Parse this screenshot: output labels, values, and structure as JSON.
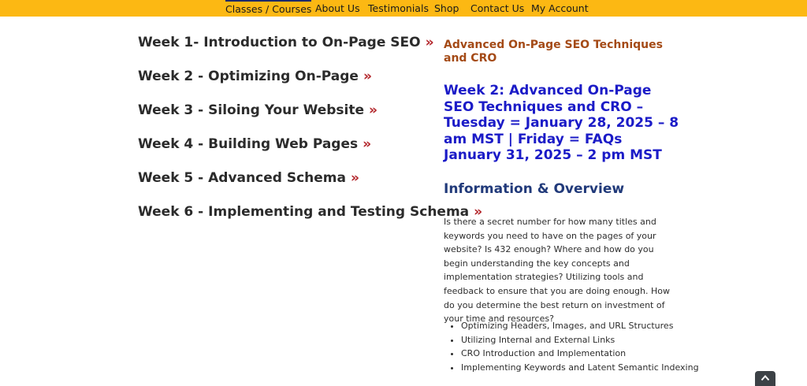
{
  "nav": {
    "items": [
      {
        "label": "Classes / Courses",
        "active": true
      },
      {
        "label": "About Us",
        "active": false
      },
      {
        "label": "Testimonials",
        "active": false
      },
      {
        "label": "Shop",
        "active": false
      },
      {
        "label": "Contact Us",
        "active": false
      },
      {
        "label": "My Account",
        "active": false
      }
    ]
  },
  "weeks": [
    {
      "label": "Week 1- Introduction to On-Page SEO",
      "arrow": "»"
    },
    {
      "label": "Week 2 - Optimizing On-Page",
      "arrow": "»"
    },
    {
      "label": "Week 3 - Siloing Your Website",
      "arrow": "»"
    },
    {
      "label": "Week 4 - Building Web Pages",
      "arrow": "»"
    },
    {
      "label": "Week 5 - Advanced Schema",
      "arrow": "»"
    },
    {
      "label": "Week 6 - Implementing and Testing Schema",
      "arrow": "»"
    }
  ],
  "sidebar": {
    "heading": "Advanced On-Page SEO Techniques and CRO",
    "week_title": "Week 2: Advanced On-Page SEO Techniques and CRO – Tuesday = January 28, 2025 – 8 am MST  | Friday = FAQs  January 31, 2025 – 2 pm MST",
    "info_heading": "Information & Overview",
    "intro": "Is there a secret number for how many titles and keywords you need to have on the pages of your website? Is 432 enough? Where and how do you begin understanding the key concepts and implementation strategies? Utilizing tools and feedback to ensure that you are doing enough. How do you determine the best return on investment of your time and resources?",
    "topics": [
      "Optimizing Headers, Images, and URL Structures",
      "Utilizing Internal and External Links",
      "CRO Introduction and Implementation",
      "Implementing Keywords and Latent Semantic Indexing"
    ]
  },
  "colors": {
    "nav_bg": "#fcb813",
    "heading_orange": "#a44a16",
    "title_blue": "#1b1bc7",
    "info_blue": "#213a7a",
    "arrow_red": "#b3262b"
  },
  "icons": {
    "back_to_top": "chevron-up-icon"
  }
}
